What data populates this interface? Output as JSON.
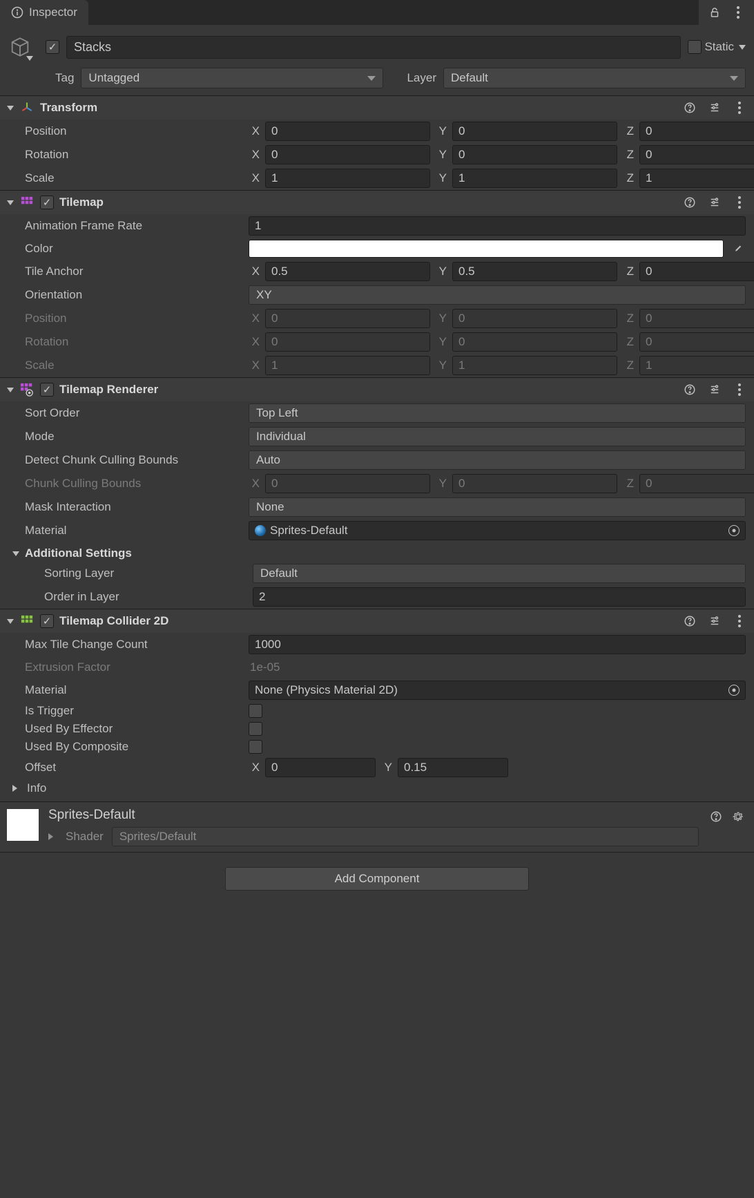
{
  "tab_title": "Inspector",
  "gameobject": {
    "name": "Stacks",
    "enabled": true,
    "static_label": "Static",
    "tag_label": "Tag",
    "tag_value": "Untagged",
    "layer_label": "Layer",
    "layer_value": "Default"
  },
  "transform": {
    "title": "Transform",
    "position_label": "Position",
    "rotation_label": "Rotation",
    "scale_label": "Scale",
    "pos": {
      "x": "0",
      "y": "0",
      "z": "0"
    },
    "rot": {
      "x": "0",
      "y": "0",
      "z": "0"
    },
    "scale": {
      "x": "1",
      "y": "1",
      "z": "1"
    }
  },
  "tilemap": {
    "title": "Tilemap",
    "enabled": true,
    "anim_label": "Animation Frame Rate",
    "anim_value": "1",
    "color_label": "Color",
    "color_value": "#FFFFFF",
    "anchor_label": "Tile Anchor",
    "anchor": {
      "x": "0.5",
      "y": "0.5",
      "z": "0"
    },
    "orientation_label": "Orientation",
    "orientation_value": "XY",
    "pos_label": "Position",
    "pos": {
      "x": "0",
      "y": "0",
      "z": "0"
    },
    "rot_label": "Rotation",
    "rot": {
      "x": "0",
      "y": "0",
      "z": "0"
    },
    "scale_label": "Scale",
    "scale": {
      "x": "1",
      "y": "1",
      "z": "1"
    }
  },
  "renderer": {
    "title": "Tilemap Renderer",
    "enabled": true,
    "sort_label": "Sort Order",
    "sort_value": "Top Left",
    "mode_label": "Mode",
    "mode_value": "Individual",
    "detect_label": "Detect Chunk Culling Bounds",
    "detect_value": "Auto",
    "chunk_label": "Chunk Culling Bounds",
    "chunk": {
      "x": "0",
      "y": "0",
      "z": "0"
    },
    "mask_label": "Mask Interaction",
    "mask_value": "None",
    "material_label": "Material",
    "material_value": "Sprites-Default",
    "additional_label": "Additional Settings",
    "sorting_layer_label": "Sorting Layer",
    "sorting_layer_value": "Default",
    "order_label": "Order in Layer",
    "order_value": "2"
  },
  "collider": {
    "title": "Tilemap Collider 2D",
    "enabled": true,
    "max_label": "Max Tile Change Count",
    "max_value": "1000",
    "extrusion_label": "Extrusion Factor",
    "extrusion_value": "1e-05",
    "material_label": "Material",
    "material_value": "None (Physics Material 2D)",
    "trigger_label": "Is Trigger",
    "effector_label": "Used By Effector",
    "composite_label": "Used By Composite",
    "offset_label": "Offset",
    "offset": {
      "x": "0",
      "y": "0.15"
    },
    "info_label": "Info"
  },
  "material": {
    "title": "Sprites-Default",
    "shader_label": "Shader",
    "shader_value": "Sprites/Default"
  },
  "add_component": "Add Component",
  "axes": {
    "x": "X",
    "y": "Y",
    "z": "Z"
  }
}
